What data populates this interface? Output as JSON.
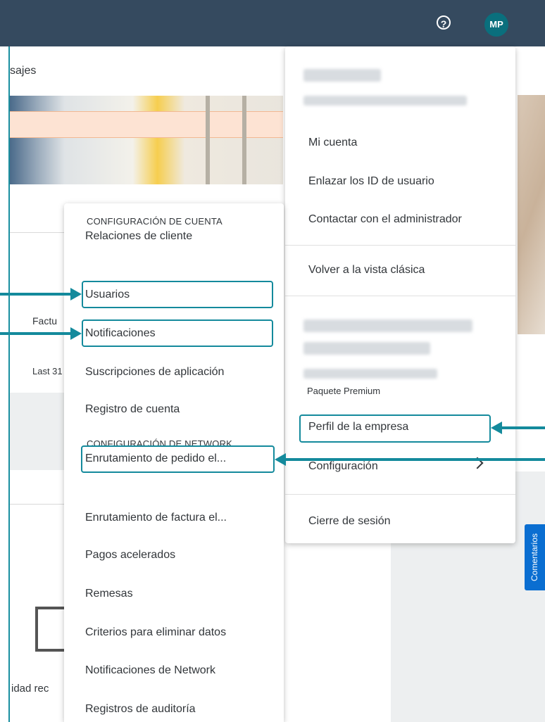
{
  "header": {
    "help_icon": "help-circle-icon",
    "help_glyph": "?",
    "avatar_initials": "MP"
  },
  "background": {
    "nav_text": "sajes",
    "card_label_fact": "Factu",
    "card_label_last": "Last 31",
    "card_label_bottom": "idad rec"
  },
  "feedback_tab": {
    "label": "Comentarios"
  },
  "user_menu": {
    "items": {
      "mi_cuenta": "Mi cuenta",
      "enlazar": "Enlazar los ID de usuario",
      "contactar": "Contactar con el administrador",
      "volver": "Volver a la vista clásica",
      "paquete": "Paquete Premium",
      "perfil": "Perfil de la empresa",
      "configuracion": "Configuración",
      "cierre": "Cierre de sesión"
    }
  },
  "settings_menu": {
    "section_cuenta": "CONFIGURACIÓN DE CUENTA",
    "section_network": "CONFIGURACIÓN DE NETWORK",
    "items": {
      "relaciones": "Relaciones de cliente",
      "usuarios": "Usuarios",
      "notificaciones": "Notificaciones",
      "suscripciones": "Suscripciones de aplicación",
      "registro": "Registro de cuenta",
      "enrut_pedido": "Enrutamiento de pedido el...",
      "enrut_factura": "Enrutamiento de factura el...",
      "pagos": "Pagos acelerados",
      "remesas": "Remesas",
      "criterios": "Criterios para eliminar datos",
      "notif_network": "Notificaciones de Network",
      "auditoria": "Registros de auditoría"
    }
  },
  "colors": {
    "topbar": "#354a5f",
    "avatar": "#0a6f7d",
    "annotation": "#148a9c",
    "feedback_tab": "#0a6ed1"
  }
}
